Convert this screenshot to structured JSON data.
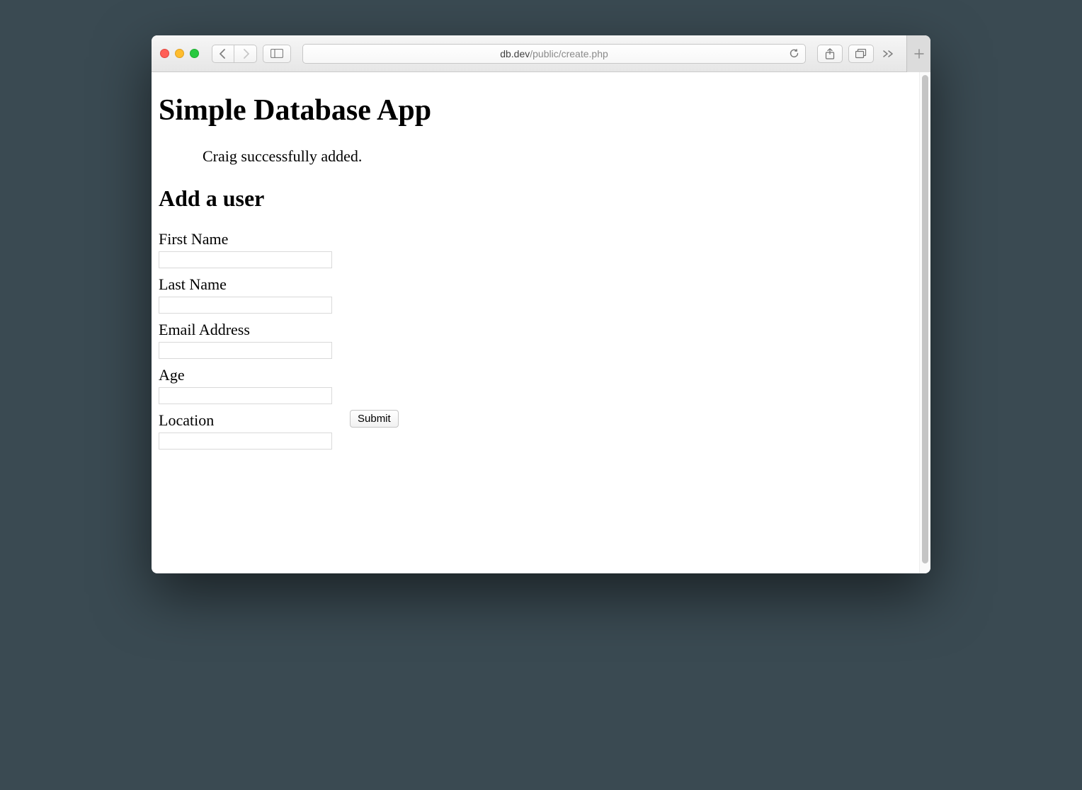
{
  "browser": {
    "address": {
      "host": "db.dev",
      "path": "/public/create.php"
    }
  },
  "page": {
    "title": "Simple Database App",
    "message": "Craig successfully added.",
    "section_heading": "Add a user",
    "form": {
      "fields": [
        {
          "label": "First Name"
        },
        {
          "label": "Last Name"
        },
        {
          "label": "Email Address"
        },
        {
          "label": "Age"
        },
        {
          "label": "Location"
        }
      ],
      "submit_label": "Submit"
    }
  }
}
